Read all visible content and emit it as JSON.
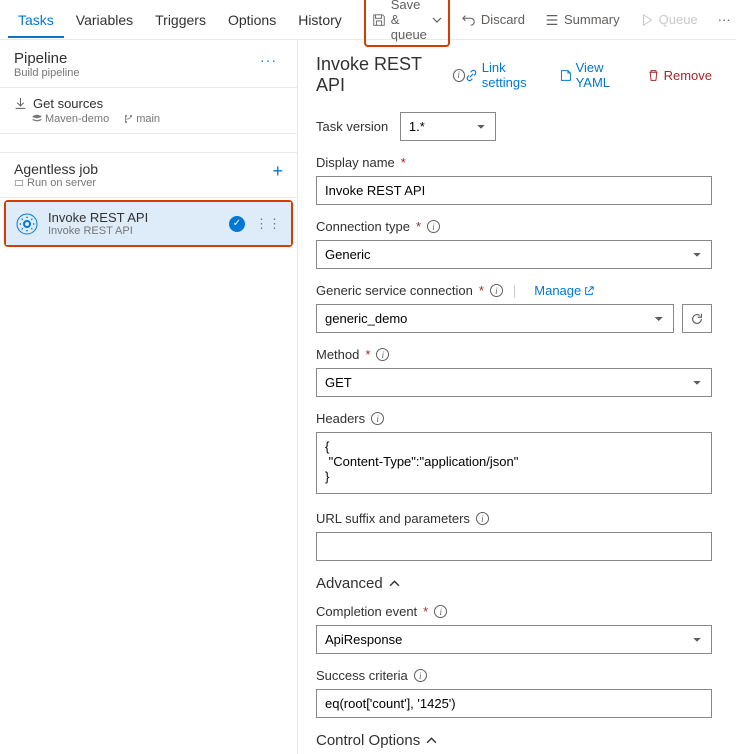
{
  "tabs": {
    "items": [
      "Tasks",
      "Variables",
      "Triggers",
      "Options",
      "History"
    ],
    "active": 0
  },
  "toolbar": {
    "save_queue": "Save & queue",
    "discard": "Discard",
    "summary": "Summary",
    "queue": "Queue",
    "more": "···"
  },
  "pipeline": {
    "title": "Pipeline",
    "subtitle": "Build pipeline",
    "more": "···"
  },
  "get_sources": {
    "title": "Get sources",
    "repo": "Maven-demo",
    "branch": "main"
  },
  "agentless": {
    "title": "Agentless job",
    "subtitle": "Run on server"
  },
  "task_item": {
    "title": "Invoke REST API",
    "subtitle": "Invoke REST API"
  },
  "right_header": {
    "title": "Invoke REST API",
    "link_settings": "Link settings",
    "view_yaml": "View YAML",
    "remove": "Remove"
  },
  "form": {
    "task_version_label": "Task version",
    "task_version_value": "1.*",
    "display_name_label": "Display name",
    "display_name_value": "Invoke REST API",
    "connection_type_label": "Connection type",
    "connection_type_value": "Generic",
    "service_conn_label": "Generic service connection",
    "manage_label": "Manage",
    "service_conn_value": "generic_demo",
    "method_label": "Method",
    "method_value": "GET",
    "headers_label": "Headers",
    "headers_value": "{\n \"Content-Type\":\"application/json\"\n}",
    "url_suffix_label": "URL suffix and parameters",
    "url_suffix_value": "",
    "advanced_label": "Advanced",
    "completion_event_label": "Completion event",
    "completion_event_value": "ApiResponse",
    "success_criteria_label": "Success criteria",
    "success_criteria_value": "eq(root['count'], '1425')",
    "control_options_label": "Control Options"
  }
}
